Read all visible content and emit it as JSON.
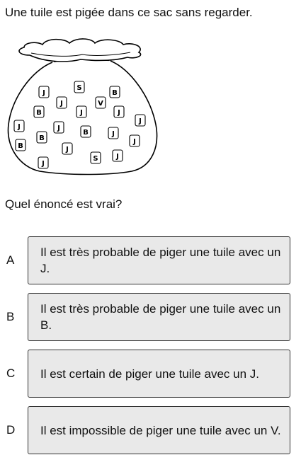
{
  "prompt": "Une tuile est pigée dans ce sac sans regarder.",
  "question": "Quel énoncé est vrai?",
  "bag": {
    "tiles": [
      {
        "letter": "S"
      },
      {
        "letter": "J"
      },
      {
        "letter": "B"
      },
      {
        "letter": "J"
      },
      {
        "letter": "V"
      },
      {
        "letter": "B"
      },
      {
        "letter": "J"
      },
      {
        "letter": "J"
      },
      {
        "letter": "J"
      },
      {
        "letter": "J"
      },
      {
        "letter": "J"
      },
      {
        "letter": "B"
      },
      {
        "letter": "J"
      },
      {
        "letter": "B"
      },
      {
        "letter": "J"
      },
      {
        "letter": "B"
      },
      {
        "letter": "J"
      },
      {
        "letter": "S"
      },
      {
        "letter": "J"
      },
      {
        "letter": "J"
      }
    ]
  },
  "options": [
    {
      "letter": "A",
      "text": "Il est très probable de piger une tuile avec un J."
    },
    {
      "letter": "B",
      "text": "Il est très probable de piger une tuile avec un B."
    },
    {
      "letter": "C",
      "text": "Il est certain de piger une tuile avec un J."
    },
    {
      "letter": "D",
      "text": "Il est impossible de piger une tuile avec un V."
    }
  ]
}
